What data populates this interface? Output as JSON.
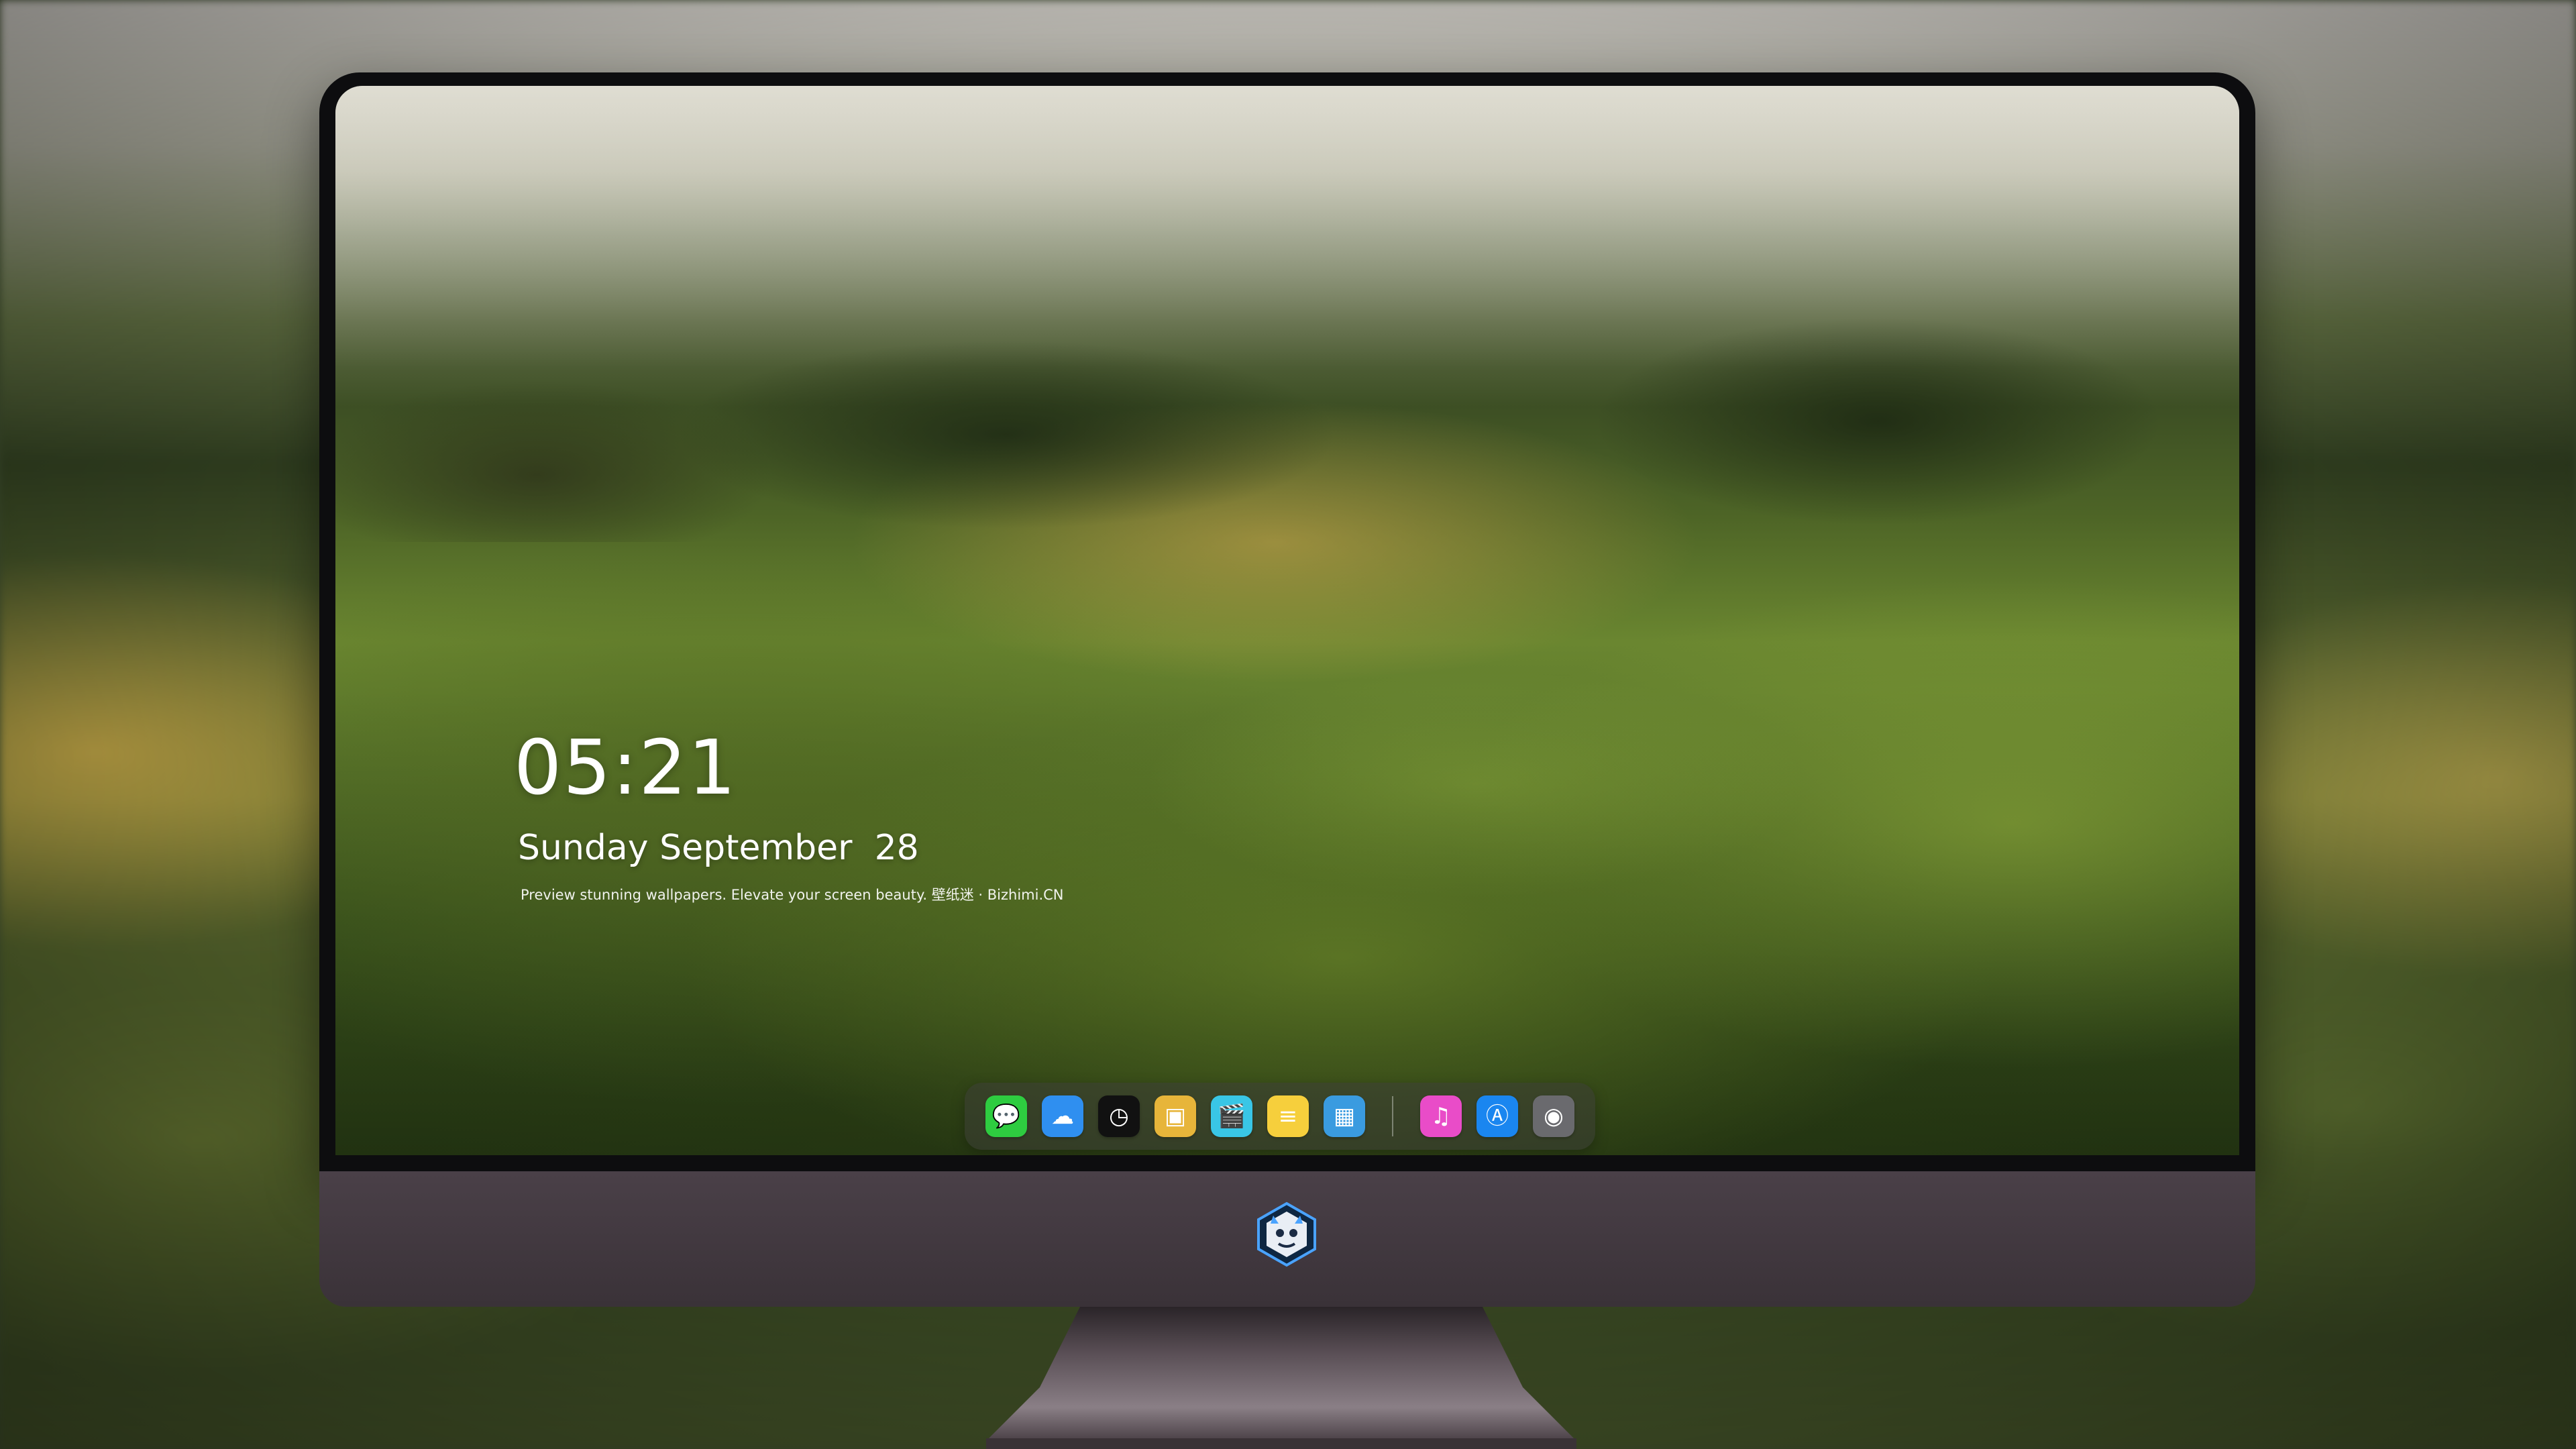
{
  "lockscreen": {
    "time": "05:21",
    "date": "Sunday September  28",
    "tagline": "Preview stunning wallpapers. Elevate your screen beauty. 壁纸迷 · Bizhimi.CN"
  },
  "dock": {
    "apps": [
      {
        "name": "messages-icon",
        "glyph": "💬",
        "color": "#2ecc40"
      },
      {
        "name": "weather-icon",
        "glyph": "☁",
        "color": "#2f8ff0"
      },
      {
        "name": "clock-icon",
        "glyph": "◷",
        "color": "#111111"
      },
      {
        "name": "preview-icon",
        "glyph": "▣",
        "color": "#e7b53a"
      },
      {
        "name": "clips-icon",
        "glyph": "🎬",
        "color": "#39c6e6"
      },
      {
        "name": "notes-icon",
        "glyph": "≡",
        "color": "#f6cf3c"
      },
      {
        "name": "photo-booth-icon",
        "glyph": "▦",
        "color": "#3a9be0"
      }
    ],
    "secondary_apps": [
      {
        "name": "music-icon",
        "glyph": "♫",
        "color": "#e94cc8"
      },
      {
        "name": "app-store-icon",
        "glyph": "Ⓐ",
        "color": "#1a86f0"
      },
      {
        "name": "camera-icon",
        "glyph": "◉",
        "color": "#6a6a6e"
      }
    ]
  },
  "colors": {
    "chin": "#3e353c",
    "dock_background": "rgba(60,62,54,0.55)",
    "logo_blue": "#2b7fd0"
  }
}
